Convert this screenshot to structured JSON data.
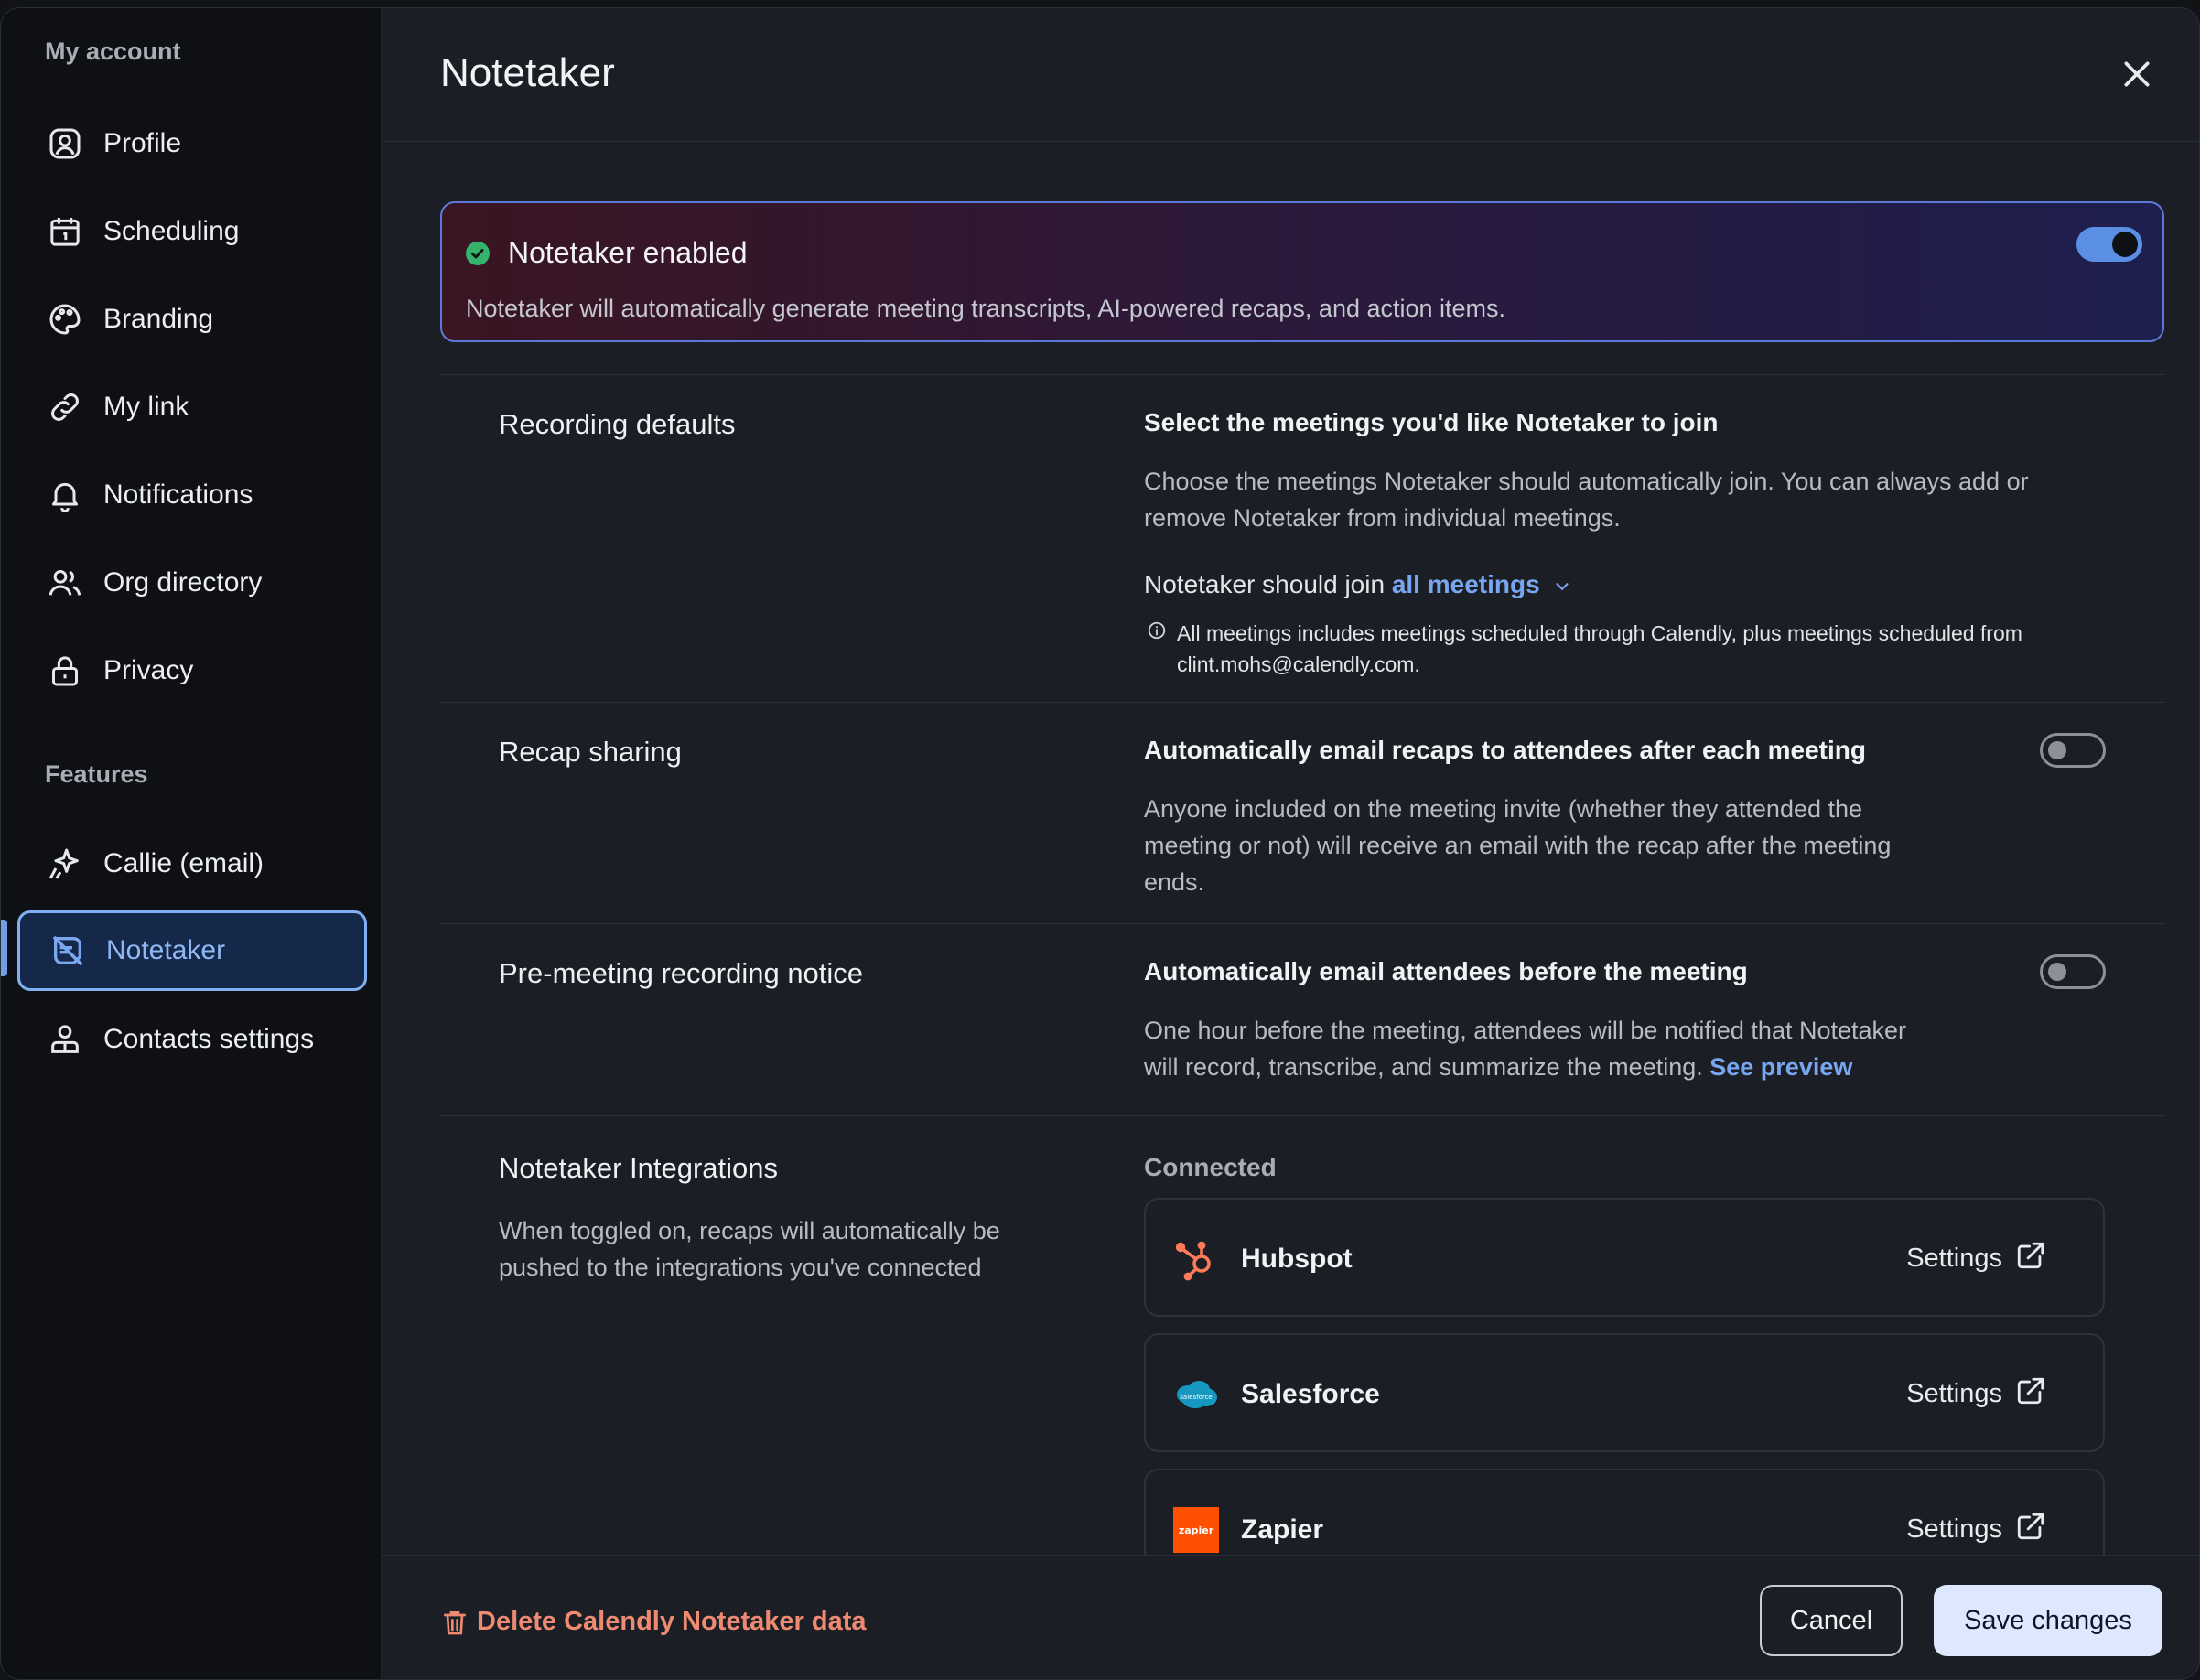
{
  "sidebar": {
    "section_account": "My account",
    "section_features": "Features",
    "items": [
      {
        "label": "Profile",
        "icon": "profile-icon"
      },
      {
        "label": "Scheduling",
        "icon": "calendar-icon"
      },
      {
        "label": "Branding",
        "icon": "palette-icon"
      },
      {
        "label": "My link",
        "icon": "link-icon"
      },
      {
        "label": "Notifications",
        "icon": "bell-icon"
      },
      {
        "label": "Org directory",
        "icon": "users-icon"
      },
      {
        "label": "Privacy",
        "icon": "lock-icon"
      }
    ],
    "features": [
      {
        "label": "Callie (email)",
        "icon": "sparkle-icon"
      },
      {
        "label": "Notetaker",
        "icon": "notetaker-icon",
        "active": true
      },
      {
        "label": "Contacts settings",
        "icon": "contacts-icon"
      }
    ]
  },
  "header": {
    "title": "Notetaker"
  },
  "banner": {
    "title": "Notetaker enabled",
    "description": "Notetaker will automatically generate meeting transcripts, AI-powered recaps, and action items.",
    "enabled": true
  },
  "recording": {
    "section_title": "Recording defaults",
    "title": "Select the meetings you'd like Notetaker to join",
    "desc_line1": "Choose the meetings Notetaker should automatically join. You can always add or",
    "desc_line2": "remove Notetaker from individual meetings.",
    "join_prefix": "Notetaker should join",
    "join_value": "all meetings",
    "info_line1": "All meetings includes meetings scheduled through Calendly, plus meetings scheduled from",
    "info_line2": "clint.mohs@calendly.com."
  },
  "recap": {
    "section_title": "Recap sharing",
    "title": "Automatically email recaps to attendees after each meeting",
    "desc_line1": "Anyone included on the meeting invite (whether they attended the",
    "desc_line2": "meeting or not) will receive an email with the recap after the meeting",
    "desc_line3": "ends.",
    "enabled": false
  },
  "premeeting": {
    "section_title": "Pre-meeting recording notice",
    "title": "Automatically email attendees before the meeting",
    "desc_line1": "One hour before the meeting, attendees will be notified that Notetaker",
    "desc_line2": "will record, transcribe, and summarize the meeting.",
    "preview_link": "See preview",
    "enabled": false
  },
  "integrations": {
    "section_title": "Notetaker Integrations",
    "desc_line1": "When toggled on, recaps will automatically be",
    "desc_line2": "pushed to the integrations you've connected",
    "connected_label": "Connected",
    "items": [
      {
        "name": "Hubspot",
        "settings": "Settings",
        "color": "#ff7a59"
      },
      {
        "name": "Salesforce",
        "settings": "Settings",
        "color": "#1798c1",
        "logo_text": "salesforce"
      },
      {
        "name": "Zapier",
        "settings": "Settings",
        "color": "#ff4f00",
        "logo_text": "zapier"
      }
    ]
  },
  "footer": {
    "delete_label": "Delete Calendly Notetaker data",
    "cancel_label": "Cancel",
    "save_label": "Save changes"
  }
}
